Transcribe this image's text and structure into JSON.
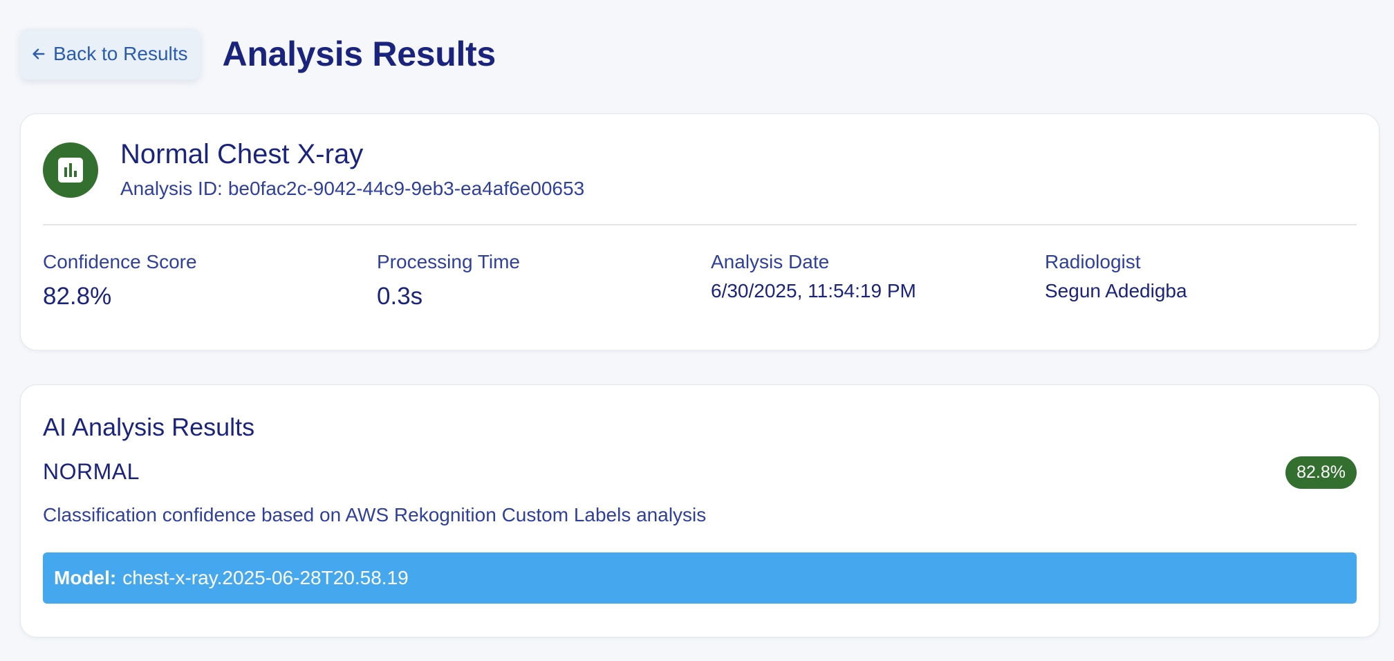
{
  "header": {
    "back_label": "Back to Results",
    "title": "Analysis Results"
  },
  "summary": {
    "icon": "bar-chart-icon",
    "title": "Normal Chest X-ray",
    "analysis_id_label": "Analysis ID:",
    "analysis_id": "be0fac2c-9042-44c9-9eb3-ea4af6e00653",
    "stats": [
      {
        "label": "Confidence Score",
        "value": "82.8%"
      },
      {
        "label": "Processing Time",
        "value": "0.3s"
      },
      {
        "label": "Analysis Date",
        "value": "6/30/2025, 11:54:19 PM"
      },
      {
        "label": "Radiologist",
        "value": "Segun Adedigba"
      }
    ]
  },
  "ai_results": {
    "title": "AI Analysis Results",
    "classification": "NORMAL",
    "confidence_badge": "82.8%",
    "description": "Classification confidence based on AWS Rekognition Custom Labels analysis",
    "model_label": "Model:",
    "model_value": "chest-x-ray.2025-06-28T20.58.19"
  },
  "colors": {
    "primary_text": "#1a237e",
    "accent_green": "#33702f",
    "model_bar": "#45a7ee",
    "page_bg": "#f5f7fa"
  }
}
